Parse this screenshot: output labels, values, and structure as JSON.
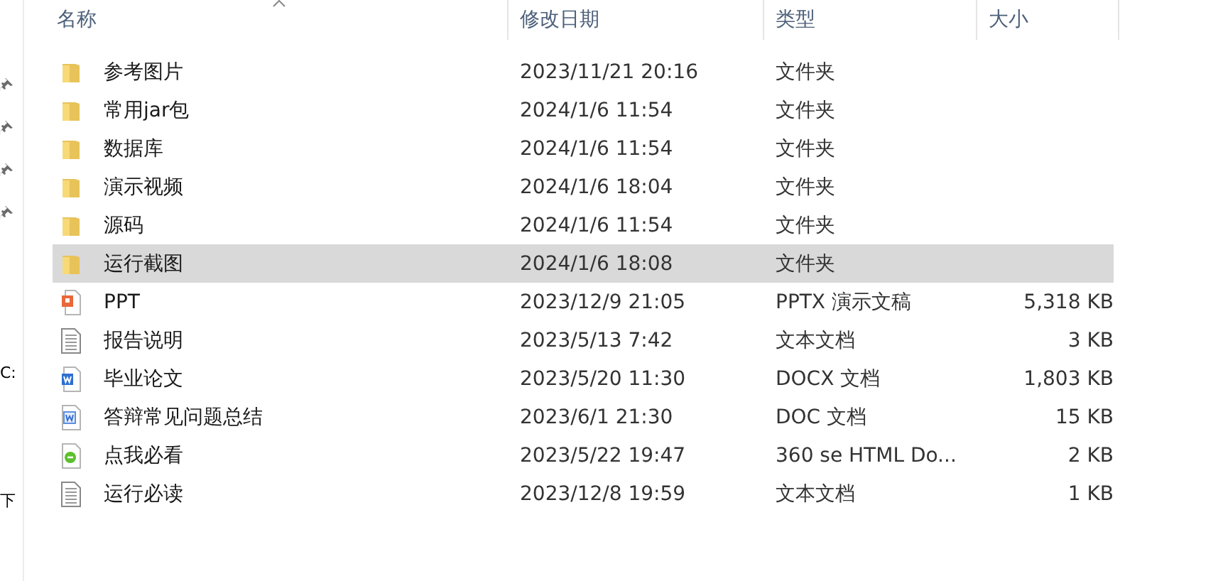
{
  "nav": {
    "items": [
      {
        "kind": "pin"
      },
      {
        "kind": "pin"
      },
      {
        "kind": "pin"
      },
      {
        "kind": "pin"
      },
      {
        "kind": "label",
        "label": "C:"
      },
      {
        "kind": "label",
        "label": "下"
      }
    ]
  },
  "table": {
    "columns": [
      {
        "label": "名称",
        "sorted": true
      },
      {
        "label": "修改日期",
        "sorted": false
      },
      {
        "label": "类型",
        "sorted": false
      },
      {
        "label": "大小",
        "sorted": false
      }
    ],
    "rows": [
      {
        "kind": "folder",
        "name": "参考图片",
        "date": "2023/11/21 20:16",
        "type": "文件夹",
        "selected": false
      },
      {
        "kind": "folder",
        "name": "常用jar包",
        "date": "2024/1/6 11:54",
        "type": "文件夹",
        "selected": false
      },
      {
        "kind": "folder",
        "name": "数据库",
        "date": "2024/1/6 11:54",
        "type": "文件夹",
        "selected": false
      },
      {
        "kind": "folder",
        "name": "演示视频",
        "date": "2024/1/6 18:04",
        "type": "文件夹",
        "selected": false
      },
      {
        "kind": "folder",
        "name": "源码",
        "date": "2024/1/6 11:54",
        "type": "文件夹",
        "selected": false
      },
      {
        "kind": "folder",
        "name": "运行截图",
        "date": "2024/1/6 18:08",
        "type": "文件夹",
        "selected": true
      },
      {
        "kind": "ppt",
        "name": "PPT",
        "date": "2023/12/9 21:05",
        "type": "PPTX 演示文稿",
        "size": "5,318 KB",
        "selected": false
      },
      {
        "kind": "text",
        "name": "报告说明",
        "date": "2023/5/13 7:42",
        "type": "文本文档",
        "size": "3 KB",
        "selected": false
      },
      {
        "kind": "docx",
        "name": "毕业论文",
        "date": "2023/5/20 11:30",
        "type": "DOCX 文档",
        "size": "1,803 KB",
        "selected": false
      },
      {
        "kind": "doc",
        "name": "答辩常见问题总结",
        "date": "2023/6/1 21:30",
        "type": "DOC 文档",
        "size": "15 KB",
        "selected": false
      },
      {
        "kind": "html",
        "name": "点我必看",
        "date": "2023/5/22 19:47",
        "type": "360 se HTML Do...",
        "size": "2 KB",
        "selected": false
      },
      {
        "kind": "text",
        "name": "运行必读",
        "date": "2023/12/8 19:59",
        "type": "文本文档",
        "size": "1 KB",
        "selected": false
      }
    ]
  }
}
